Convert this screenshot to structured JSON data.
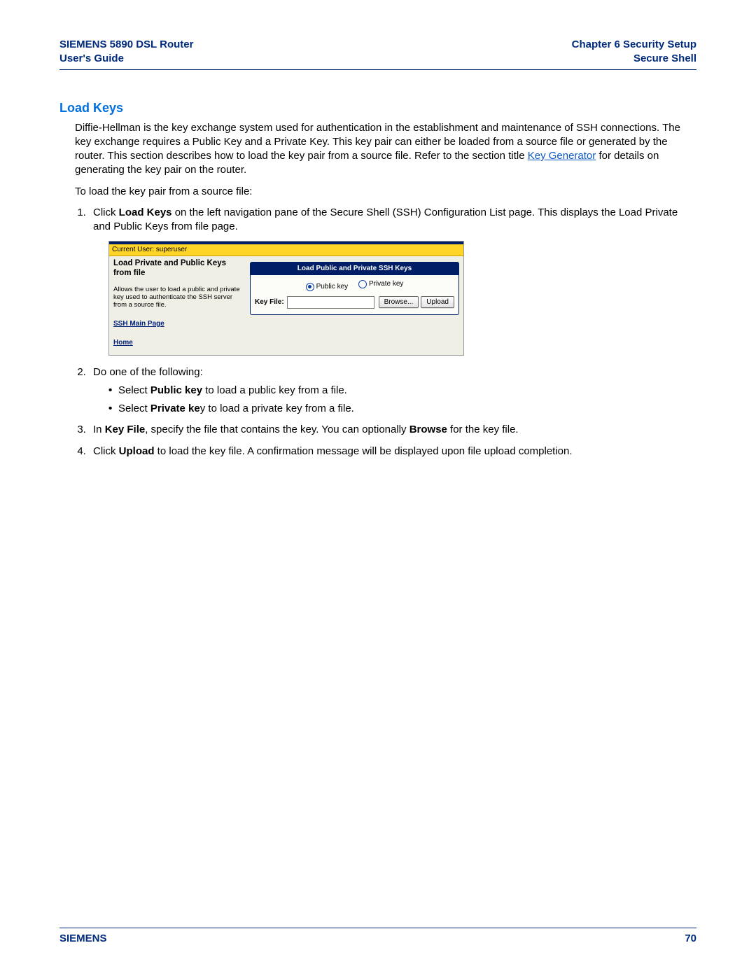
{
  "header": {
    "left_line1": "SIEMENS 5890 DSL Router",
    "left_line2": "User's Guide",
    "right_line1": "Chapter 6  Security Setup",
    "right_line2": "Secure Shell"
  },
  "title": "Load Keys",
  "intro1_a": "Diffie-Hellman is the key exchange system used for authentication in the establishment and maintenance of SSH connections. The key exchange requires a Public Key and a Private Key. This key pair can either be loaded from a source file or generated by the router. This section describes how to load the key pair from a source file. Refer to the section title ",
  "intro1_link": "Key Generator",
  "intro1_b": " for details on generating the key pair on the router.",
  "intro2": "To load the key pair from a source file:",
  "step1_a": "Click ",
  "step1_bold": "Load Keys",
  "step1_b": " on the left navigation pane of the Secure Shell (SSH) Configuration List page. This displays the Load Private and Public Keys from file page.",
  "screenshot": {
    "current_user": "Current User: superuser",
    "panel_title": "Load Private and Public Keys from file",
    "panel_desc": "Allows the user to load a public and private key used to authenticate the SSH server from a source file.",
    "link_ssh": "SSH Main Page",
    "link_home": "Home",
    "right_header": "Load Public and Private SSH Keys",
    "radio_public": "Public key",
    "radio_private": "Private key",
    "keyfile_label": "Key File:",
    "browse": "Browse...",
    "upload": "Upload"
  },
  "step2": "Do one of the following:",
  "bullet1_a": "Select ",
  "bullet1_bold": "Public key",
  "bullet1_b": " to load a public key from a file.",
  "bullet2_a": "Select ",
  "bullet2_bold": "Private ke",
  "bullet2_b": "y to load a private key from a file.",
  "step3_a": "In ",
  "step3_bold1": "Key File",
  "step3_b": ", specify the file that contains the key. You can optionally ",
  "step3_bold2": "Browse",
  "step3_c": " for the key file.",
  "step4_a": "Click ",
  "step4_bold": "Upload",
  "step4_b": " to load the key file. A confirmation message will be displayed upon file upload completion.",
  "footer": {
    "brand": "SIEMENS",
    "page": "70"
  }
}
